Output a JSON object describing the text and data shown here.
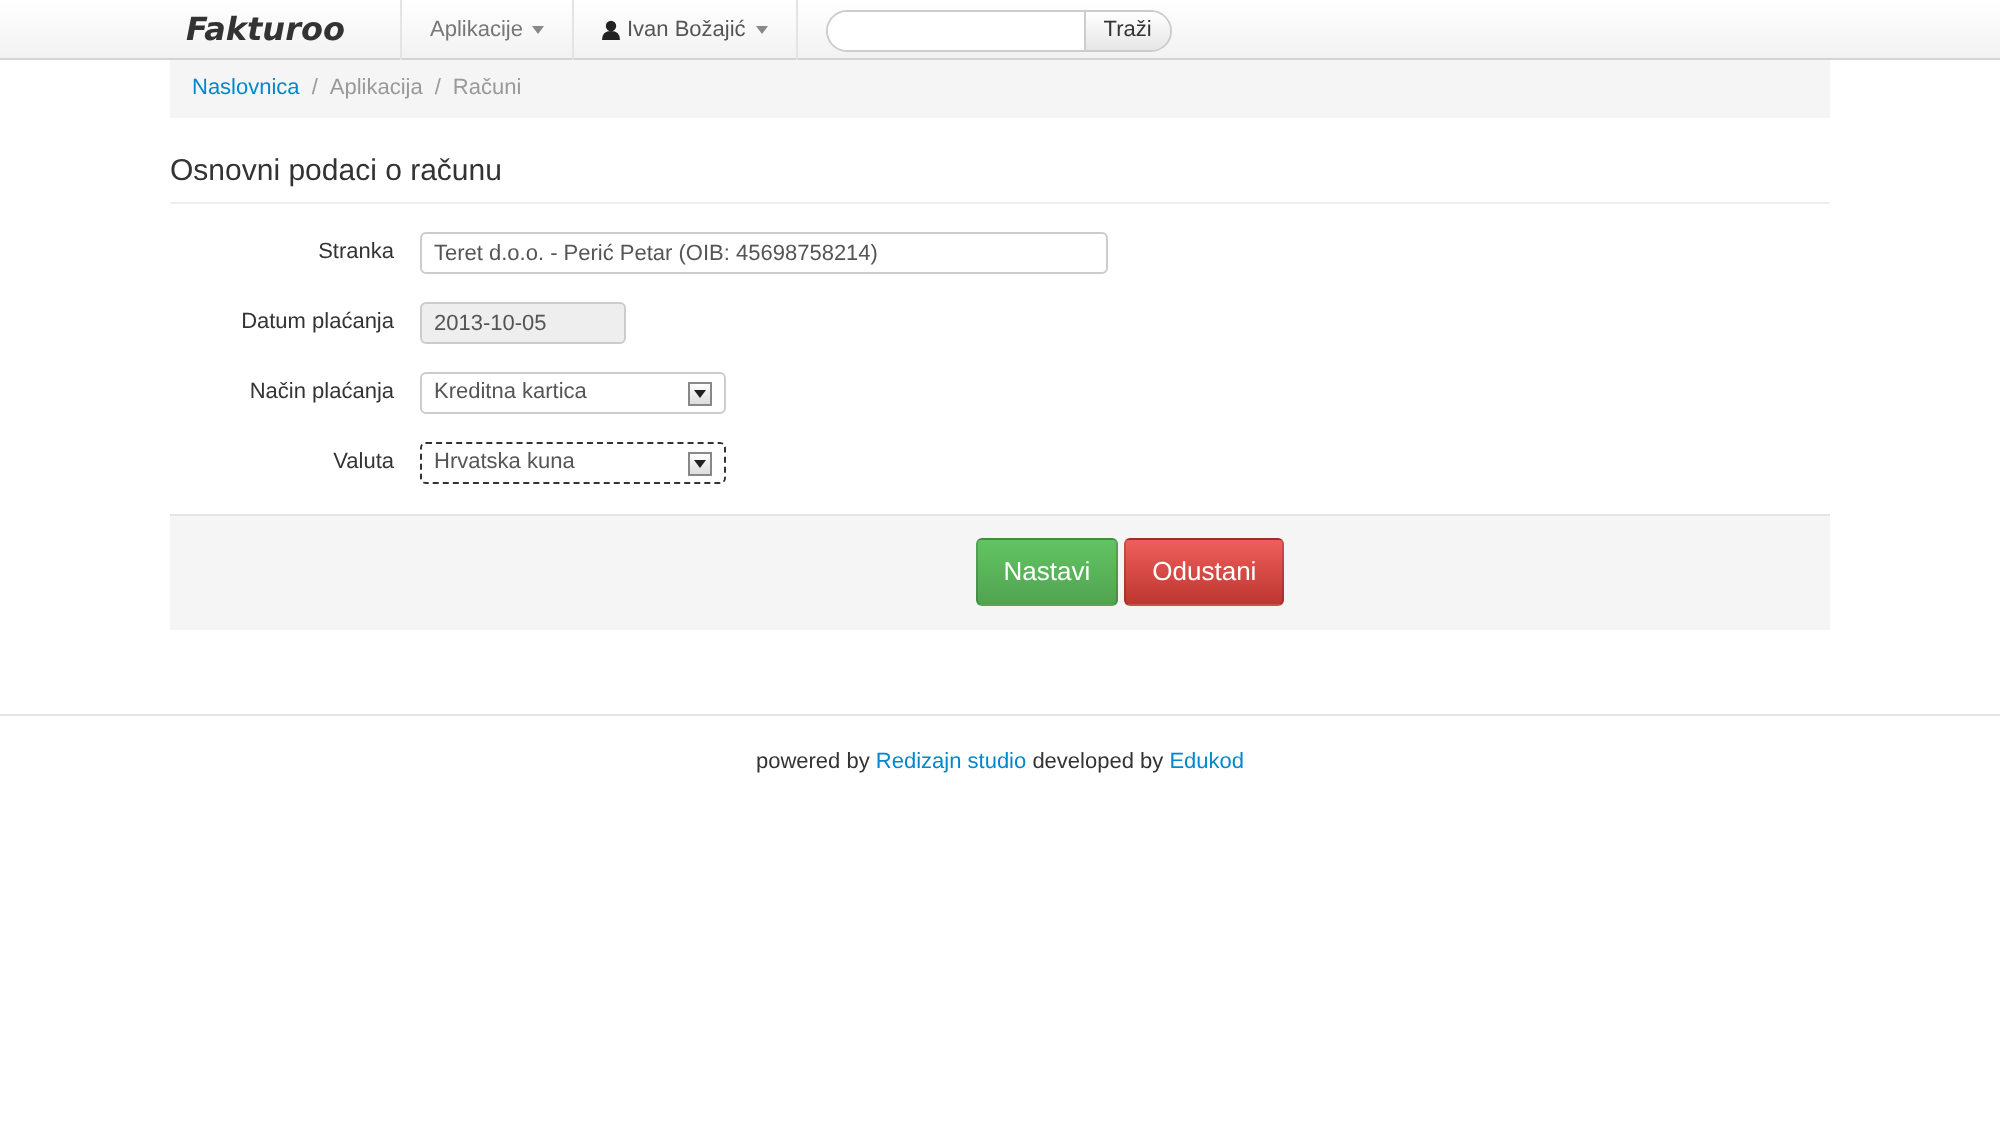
{
  "navbar": {
    "brand": "Fakturoo",
    "menus": [
      {
        "label": "Aplikacije",
        "kind": "plain"
      },
      {
        "label": "Ivan Božajić",
        "kind": "user"
      }
    ],
    "search": {
      "button": "Traži"
    }
  },
  "breadcrumb": [
    {
      "label": "Naslovnica",
      "kind": "link"
    },
    {
      "separator": "/",
      "label": "Aplikacija",
      "kind": "text"
    },
    {
      "separator": "/",
      "label": "Računi",
      "kind": "text"
    }
  ],
  "form": {
    "title": "Osnovni podaci o računu",
    "fields": [
      {
        "label": "Stranka",
        "kind": "text",
        "value": "Teret d.o.o. - Perić Petar (OIB: 45698758214)",
        "disabled": false,
        "focused": false
      },
      {
        "label": "Datum plaćanja",
        "kind": "text",
        "value": "2013-10-05",
        "disabled": true,
        "focused": false
      },
      {
        "label": "Način plaćanja",
        "kind": "select",
        "value": "Kreditna kartica",
        "disabled": false,
        "focused": false
      },
      {
        "label": "Valuta",
        "kind": "select",
        "value": "Hrvatska kuna",
        "disabled": false,
        "focused": true
      }
    ],
    "buttons": [
      {
        "label": "Nastavi",
        "kind": "success"
      },
      {
        "label": "Odustani",
        "kind": "danger"
      }
    ]
  },
  "footer": [
    {
      "text": "powered by",
      "kind": "text"
    },
    {
      "text": "Redizajn studio",
      "kind": "link"
    },
    {
      "text": "developed by",
      "kind": "text"
    },
    {
      "text": "Edukod",
      "kind": "link"
    }
  ]
}
